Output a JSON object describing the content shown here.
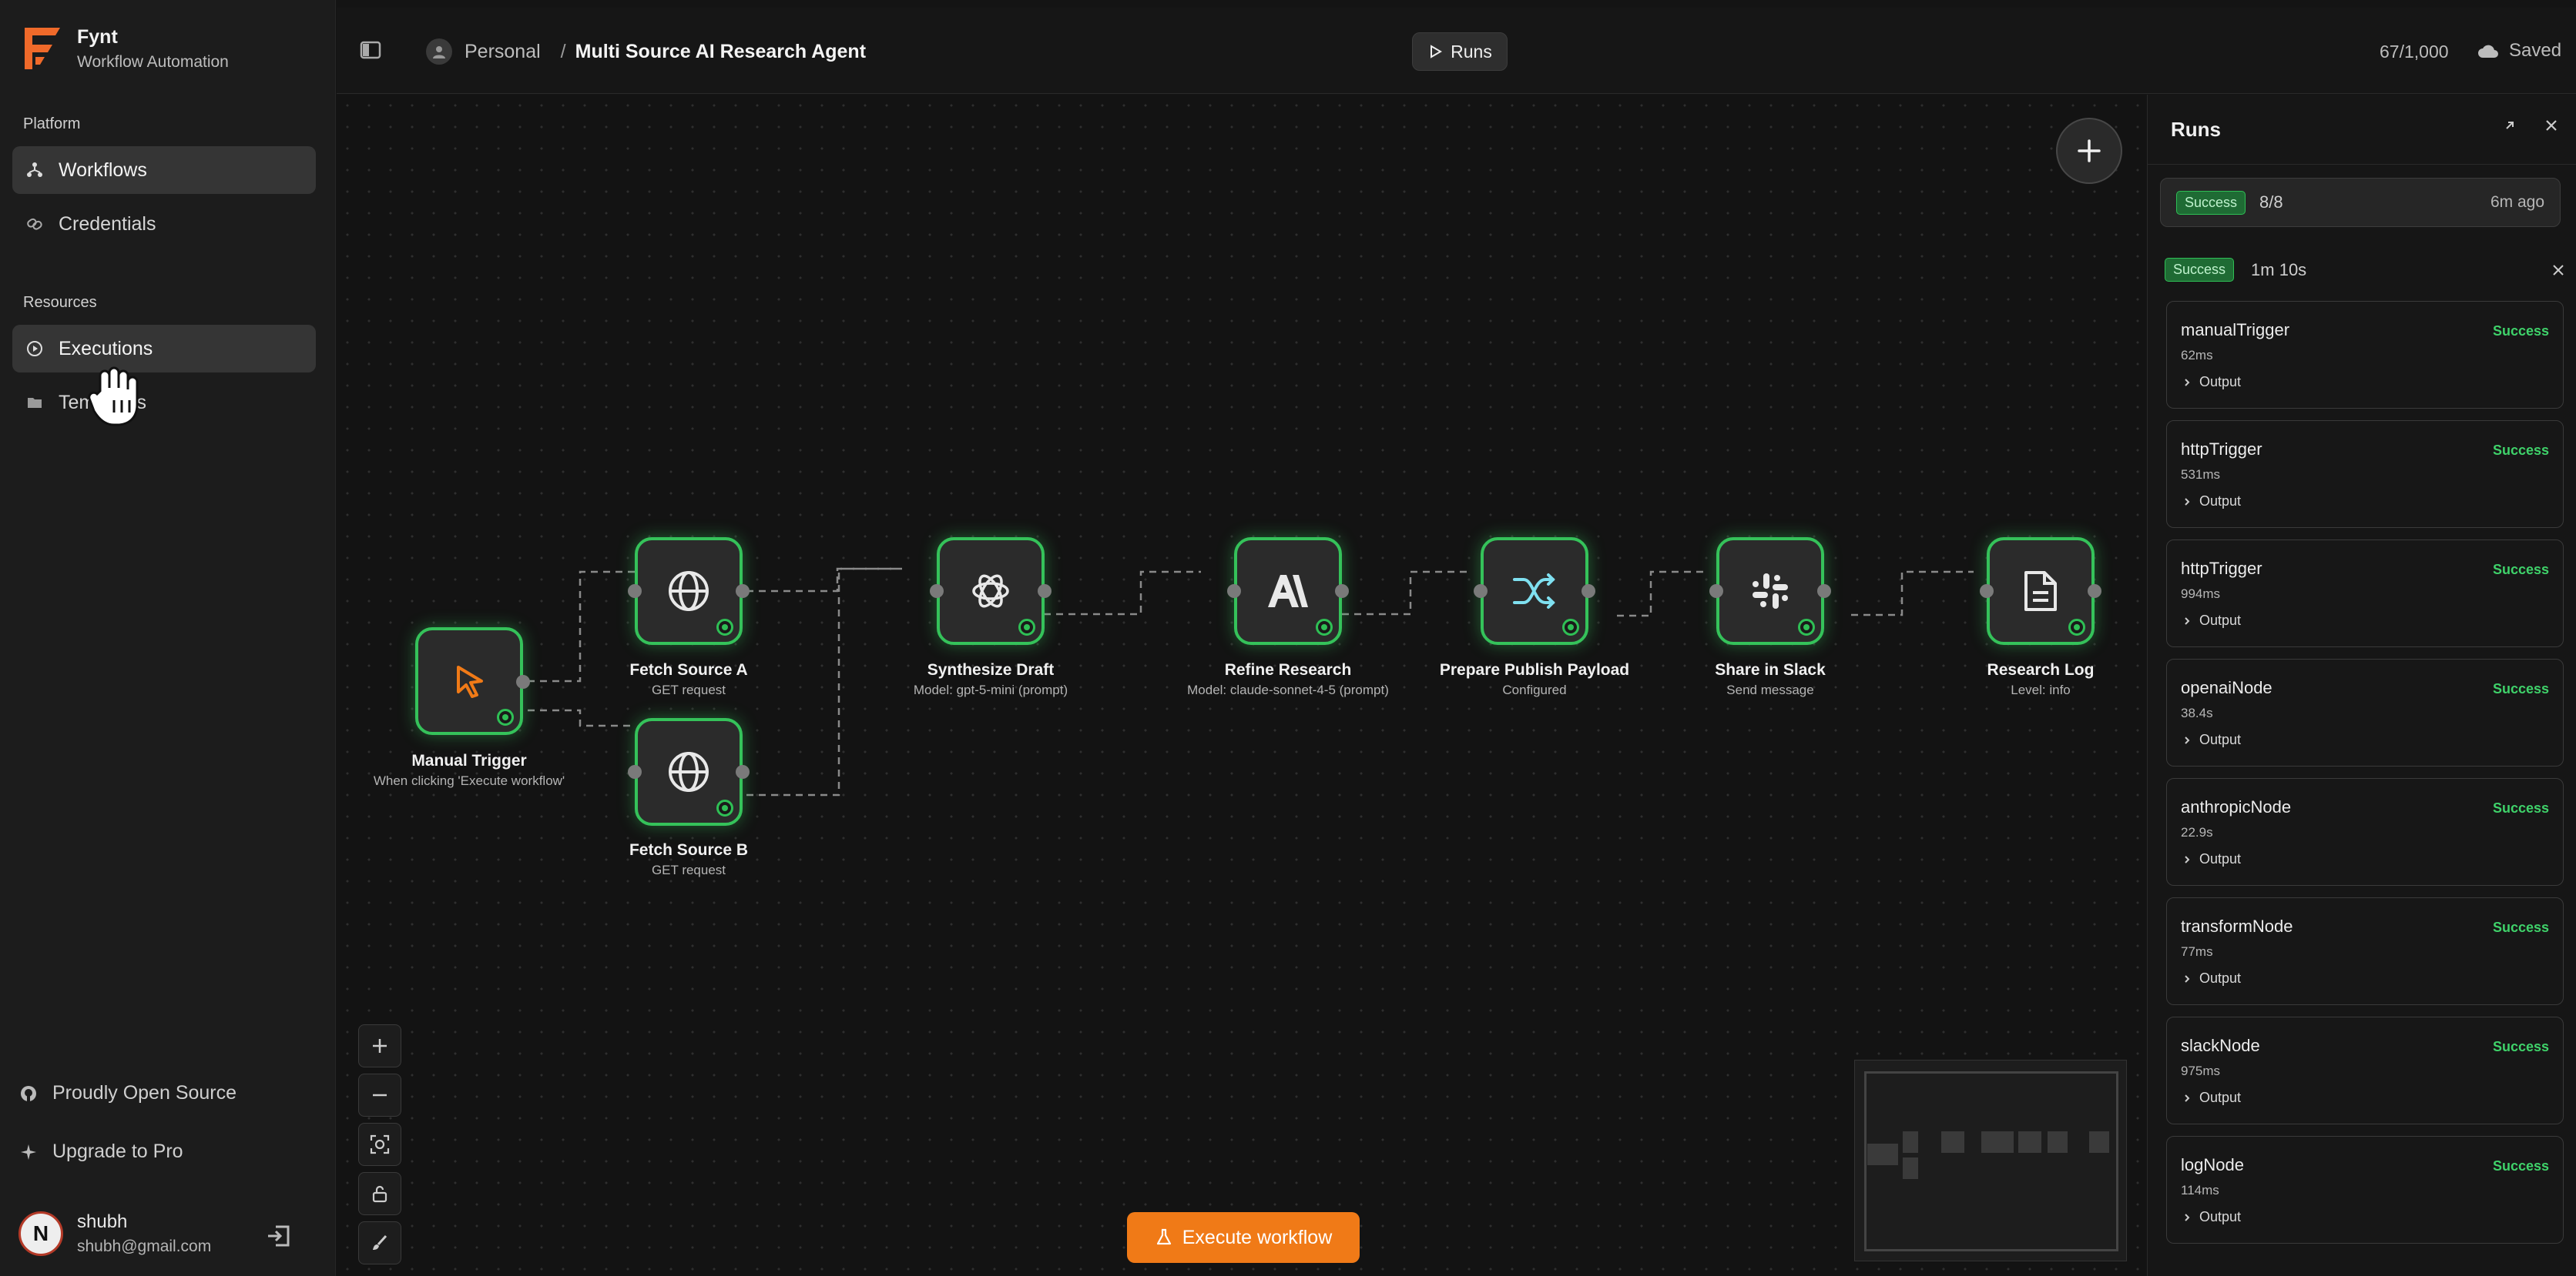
{
  "brand": {
    "name": "Fynt",
    "subtitle": "Workflow Automation"
  },
  "sidebar": {
    "platform_label": "Platform",
    "platform_items": [
      {
        "label": "Workflows",
        "icon": "workflow-icon",
        "active": true
      },
      {
        "label": "Credentials",
        "icon": "link-icon",
        "active": false
      }
    ],
    "resources_label": "Resources",
    "resources_items": [
      {
        "label": "Executions",
        "icon": "play-circle-icon",
        "active": true
      },
      {
        "label": "Templates",
        "icon": "folder-icon",
        "active": false
      }
    ],
    "bottom_links": [
      {
        "label": "Proudly Open Source",
        "icon": "github-icon"
      },
      {
        "label": "Upgrade to Pro",
        "icon": "sparkle-icon"
      }
    ],
    "user": {
      "initial": "N",
      "name": "shubh",
      "email": "shubh@gmail.com"
    }
  },
  "topbar": {
    "workspace": "Personal",
    "separator": "/",
    "workflow_name": "Multi Source AI Research Agent",
    "runs_button": "Runs",
    "counter": "67/1,000",
    "save_status": "Saved"
  },
  "canvas": {
    "nodes": [
      {
        "id": "manual",
        "label": "Manual Trigger",
        "sub": "When clicking 'Execute workflow'",
        "icon": "cursor-click-icon"
      },
      {
        "id": "fetchA",
        "label": "Fetch Source A",
        "sub": "GET request",
        "icon": "globe-icon"
      },
      {
        "id": "fetchB",
        "label": "Fetch Source B",
        "sub": "GET request",
        "icon": "globe-icon"
      },
      {
        "id": "synth",
        "label": "Synthesize Draft",
        "sub": "Model: gpt-5-mini (prompt)",
        "icon": "openai-icon"
      },
      {
        "id": "refine",
        "label": "Refine Research",
        "sub": "Model: claude-sonnet-4-5 (prompt)",
        "icon": "anthropic-icon"
      },
      {
        "id": "prepare",
        "label": "Prepare Publish Payload",
        "sub": "Configured",
        "icon": "shuffle-icon"
      },
      {
        "id": "slack",
        "label": "Share in Slack",
        "sub": "Send message",
        "icon": "slack-icon"
      },
      {
        "id": "log",
        "label": "Research Log",
        "sub": "Level: info",
        "icon": "document-icon"
      }
    ],
    "execute_button": "Execute workflow"
  },
  "runs_panel": {
    "title": "Runs",
    "summary": {
      "status": "Success",
      "count": "8/8",
      "ago": "6m ago"
    },
    "detail": {
      "status": "Success",
      "duration": "1m 10s"
    },
    "output_label": "Output",
    "steps": [
      {
        "name": "manualTrigger",
        "status": "Success",
        "time": "62ms"
      },
      {
        "name": "httpTrigger",
        "status": "Success",
        "time": "531ms"
      },
      {
        "name": "httpTrigger",
        "status": "Success",
        "time": "994ms"
      },
      {
        "name": "openaiNode",
        "status": "Success",
        "time": "38.4s"
      },
      {
        "name": "anthropicNode",
        "status": "Success",
        "time": "22.9s"
      },
      {
        "name": "transformNode",
        "status": "Success",
        "time": "77ms"
      },
      {
        "name": "slackNode",
        "status": "Success",
        "time": "975ms"
      },
      {
        "name": "logNode",
        "status": "Success",
        "time": "114ms"
      }
    ]
  },
  "colors": {
    "accent": "#f07a17",
    "success": "#35c25a",
    "background": "#141414"
  }
}
